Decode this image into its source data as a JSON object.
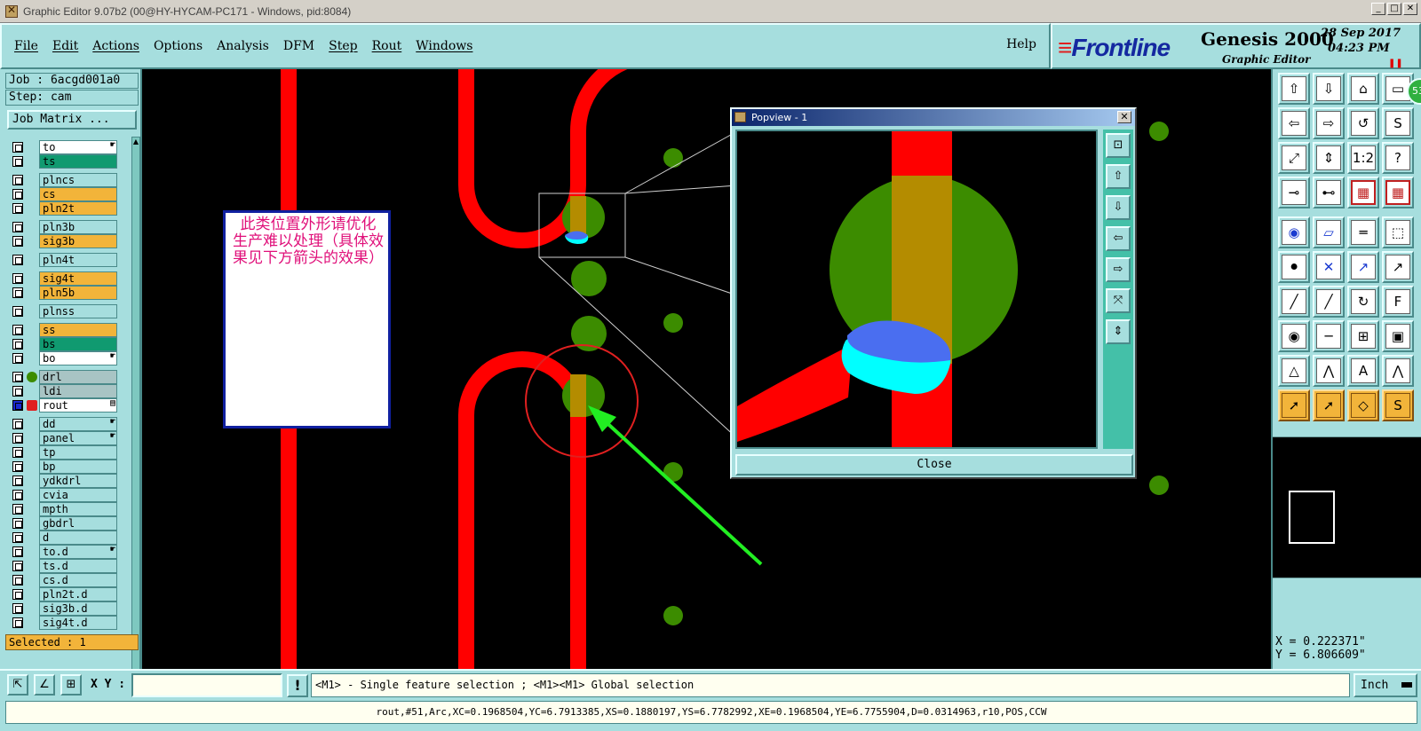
{
  "window": {
    "title": "Graphic Editor 9.07b2 (00@HY-HYCAM-PC171 - Windows, pid:8084)",
    "buttons": [
      "_",
      "□",
      "✕"
    ]
  },
  "menu": {
    "items": [
      "File",
      "Edit",
      "Actions",
      "Options",
      "Analysis",
      "DFM",
      "Step",
      "Rout",
      "Windows"
    ],
    "help": "Help"
  },
  "logo": {
    "brand": "Frontline",
    "product": "Genesis 2000",
    "subtitle": "Graphic Editor",
    "date": "28 Sep 2017",
    "time": "04:23 PM"
  },
  "left": {
    "job": "Job : 6acgd001a0",
    "step": "Step: cam",
    "job_matrix": "Job Matrix ...",
    "selected": "Selected : 1",
    "layers": [
      {
        "name": "to",
        "color": "white",
        "mark": "☛"
      },
      {
        "name": "ts",
        "color": "green",
        "mark": ""
      },
      {
        "name": "plncs",
        "color": "plain",
        "mark": ""
      },
      {
        "name": "cs",
        "color": "orange",
        "mark": ""
      },
      {
        "name": "pln2t",
        "color": "orange",
        "mark": ""
      },
      {
        "name": "pln3b",
        "color": "plain",
        "mark": ""
      },
      {
        "name": "sig3b",
        "color": "orange",
        "mark": ""
      },
      {
        "name": "pln4t",
        "color": "plain",
        "mark": ""
      },
      {
        "name": "sig4t",
        "color": "orange",
        "mark": ""
      },
      {
        "name": "pln5b",
        "color": "orange",
        "mark": ""
      },
      {
        "name": "plnss",
        "color": "plain",
        "mark": ""
      },
      {
        "name": "ss",
        "color": "orange",
        "mark": ""
      },
      {
        "name": "bs",
        "color": "green",
        "mark": ""
      },
      {
        "name": "bo",
        "color": "white",
        "mark": "☛"
      },
      {
        "name": "drl",
        "color": "grey",
        "mark": ""
      },
      {
        "name": "ldi",
        "color": "grey",
        "mark": ""
      },
      {
        "name": "rout",
        "color": "white",
        "mark": "▤"
      },
      {
        "name": "dd",
        "color": "plain",
        "mark": "☛"
      },
      {
        "name": "panel",
        "color": "plain",
        "mark": "☛"
      },
      {
        "name": "tp",
        "color": "plain",
        "mark": ""
      },
      {
        "name": "bp",
        "color": "plain",
        "mark": ""
      },
      {
        "name": "ydkdrl",
        "color": "plain",
        "mark": ""
      },
      {
        "name": "cvia",
        "color": "plain",
        "mark": ""
      },
      {
        "name": "mpth",
        "color": "plain",
        "mark": ""
      },
      {
        "name": "gbdrl",
        "color": "plain",
        "mark": ""
      },
      {
        "name": "d",
        "color": "plain",
        "mark": ""
      },
      {
        "name": "to.d",
        "color": "plain",
        "mark": "☛"
      },
      {
        "name": "ts.d",
        "color": "plain",
        "mark": ""
      },
      {
        "name": "cs.d",
        "color": "plain",
        "mark": ""
      },
      {
        "name": "pln2t.d",
        "color": "plain",
        "mark": ""
      },
      {
        "name": "sig3b.d",
        "color": "plain",
        "mark": ""
      },
      {
        "name": "sig4t.d",
        "color": "plain",
        "mark": ""
      }
    ]
  },
  "annotation": {
    "text": "此类位置外形请优化　生产难以处理（具体效果见下方箭头的效果）"
  },
  "popview": {
    "title": "Popview - 1",
    "close": "Close",
    "tools": [
      "⊡",
      "⇧",
      "⇩",
      "⇦",
      "⇨",
      "⤧",
      "⇕"
    ]
  },
  "right": {
    "badge": "53",
    "tools": [
      "⇧",
      "⇩",
      "⌂",
      "▭",
      "⇦",
      "⇨",
      "↺",
      "S",
      "⤢",
      "⇕",
      "1:2",
      "?",
      "⊸",
      "⊷",
      "▦",
      "▦",
      "◉",
      "▱",
      "═",
      "⬚",
      "⚫",
      "✕",
      "↗",
      "↗",
      "╱",
      "╱",
      "↻",
      "F",
      "◉",
      "─",
      "⊞",
      "▣",
      "△",
      "⋀",
      "A",
      "⋀",
      "➚",
      "➚",
      "◇",
      "S"
    ],
    "x_readout": "X = 0.222371\"",
    "y_readout": "Y = 6.806609\""
  },
  "bottom": {
    "xy_label": "X Y :",
    "xy_value": "",
    "prompt": "<M1> - Single feature selection ; <M1><M1> Global selection",
    "units": "Inch",
    "status": "rout,#51,Arc,XC=0.1968504,YC=6.7913385,XS=0.1880197,YS=6.7782992,XE=0.1968504,YE=6.7755904,D=0.0314963,r10,POS,CCW"
  },
  "colors": {
    "panel": "#a6dede",
    "trace": "#ff0000",
    "pad": "#3c8c00",
    "overlap": "#b48c00",
    "selection_blue": "#4a6ef0",
    "selection_cyan": "#00ffff",
    "arrow": "#22ee22",
    "annotation_text": "#e0107a"
  }
}
